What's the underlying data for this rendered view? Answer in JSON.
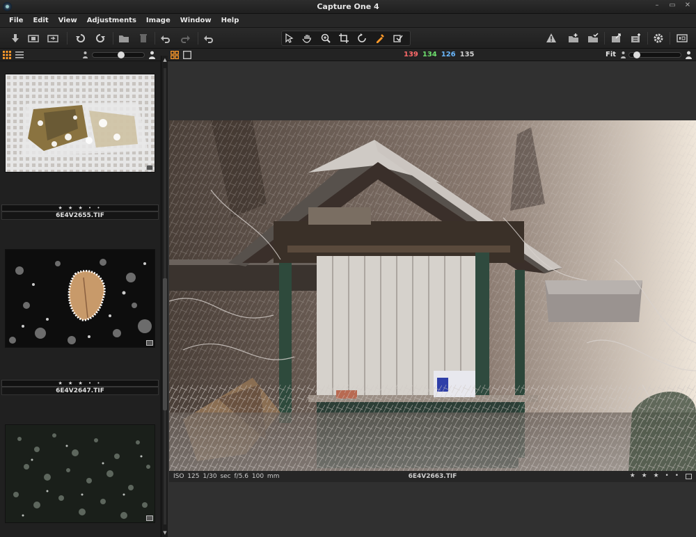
{
  "window": {
    "title": "Capture One 4",
    "controls": [
      "–",
      "▭",
      "✕"
    ]
  },
  "menu": [
    "File",
    "Edit",
    "View",
    "Adjustments",
    "Image",
    "Window",
    "Help"
  ],
  "viewer_header": {
    "color_readout": {
      "r": "139",
      "g": "134",
      "b": "126",
      "l": "135"
    },
    "zoom_label": "Fit",
    "colors": {
      "r": "#ff6a6a",
      "g": "#6ee06e",
      "b": "#6ab8ff",
      "l": "#d0d0d0",
      "accent": "#ff9a2a"
    }
  },
  "browser": {
    "thumbnails": [
      {
        "stars": "★ ★ ★ • •",
        "filename": "6E4V2655.TIF"
      },
      {
        "stars": "★ ★ ★ • •",
        "filename": "6E4V2647.TIF"
      },
      {
        "stars": "",
        "filename": ""
      }
    ]
  },
  "viewer": {
    "meta": {
      "iso": "ISO 125",
      "shutter": "1/30 sec",
      "aperture": "f/5.6",
      "focal": "100 mm"
    },
    "filename": "6E4V2663.TIF",
    "stars": "★ ★ ★ • •"
  }
}
